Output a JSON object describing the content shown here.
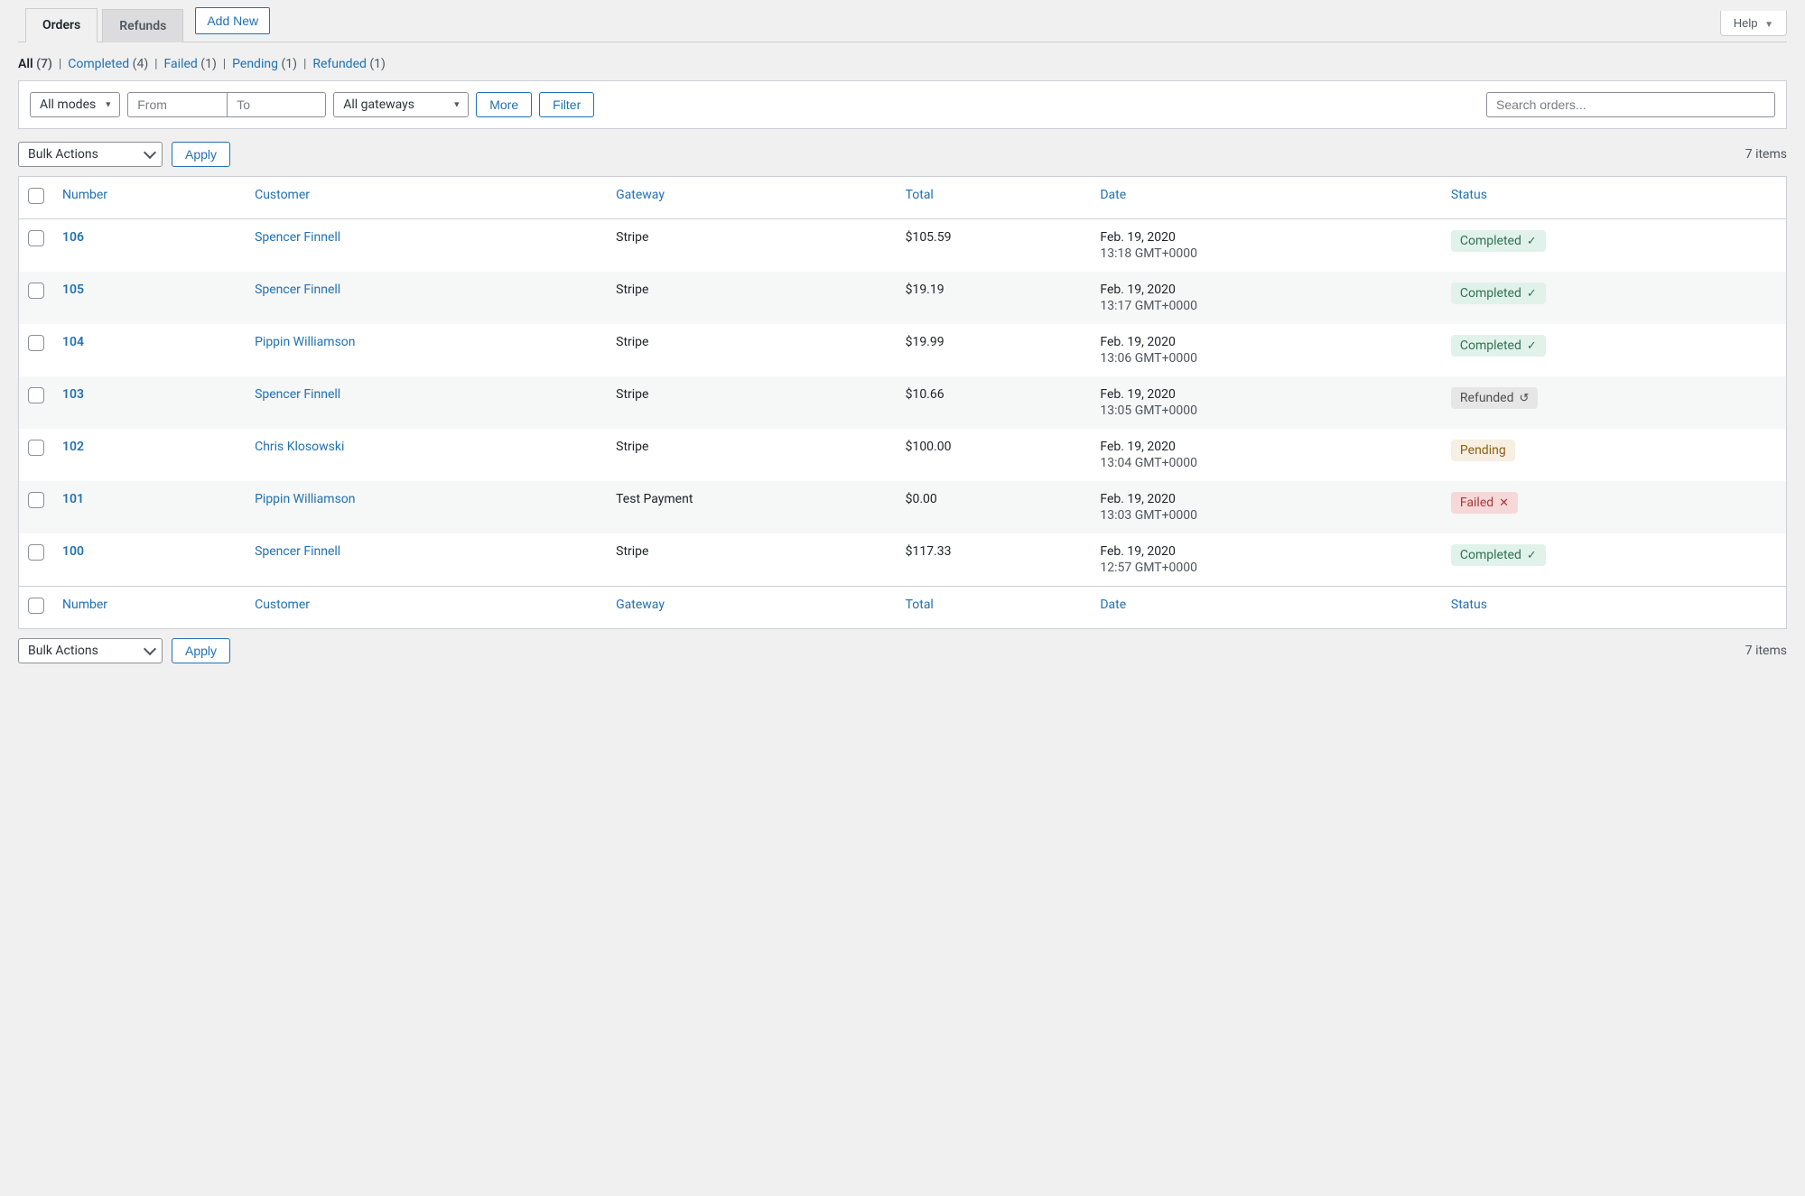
{
  "help_label": "Help",
  "tabs": {
    "orders": "Orders",
    "refunds": "Refunds",
    "add_new": "Add New"
  },
  "filters": {
    "all_label": "All",
    "all_count": "(7)",
    "completed_label": "Completed",
    "completed_count": "(4)",
    "failed_label": "Failed",
    "failed_count": "(1)",
    "pending_label": "Pending",
    "pending_count": "(1)",
    "refunded_label": "Refunded",
    "refunded_count": "(1)"
  },
  "toolbar": {
    "modes_label": "All modes",
    "from_placeholder": "From",
    "to_placeholder": "To",
    "gateways_label": "All gateways",
    "more_label": "More",
    "filter_label": "Filter",
    "search_placeholder": "Search orders...",
    "bulk_label": "Bulk Actions",
    "apply_label": "Apply",
    "item_count": "7 items"
  },
  "columns": {
    "number": "Number",
    "customer": "Customer",
    "gateway": "Gateway",
    "total": "Total",
    "date": "Date",
    "status": "Status"
  },
  "rows": [
    {
      "number": "106",
      "customer": "Spencer Finnell",
      "gateway": "Stripe",
      "total": "$105.59",
      "date": "Feb. 19, 2020",
      "time": "13:18 GMT+0000",
      "status": "Completed",
      "status_kind": "completed",
      "status_icon": "✓"
    },
    {
      "number": "105",
      "customer": "Spencer Finnell",
      "gateway": "Stripe",
      "total": "$19.19",
      "date": "Feb. 19, 2020",
      "time": "13:17 GMT+0000",
      "status": "Completed",
      "status_kind": "completed",
      "status_icon": "✓"
    },
    {
      "number": "104",
      "customer": "Pippin Williamson",
      "gateway": "Stripe",
      "total": "$19.99",
      "date": "Feb. 19, 2020",
      "time": "13:06 GMT+0000",
      "status": "Completed",
      "status_kind": "completed",
      "status_icon": "✓"
    },
    {
      "number": "103",
      "customer": "Spencer Finnell",
      "gateway": "Stripe",
      "total": "$10.66",
      "date": "Feb. 19, 2020",
      "time": "13:05 GMT+0000",
      "status": "Refunded",
      "status_kind": "refunded",
      "status_icon": "↺"
    },
    {
      "number": "102",
      "customer": "Chris Klosowski",
      "gateway": "Stripe",
      "total": "$100.00",
      "date": "Feb. 19, 2020",
      "time": "13:04 GMT+0000",
      "status": "Pending",
      "status_kind": "pending",
      "status_icon": ""
    },
    {
      "number": "101",
      "customer": "Pippin Williamson",
      "gateway": "Test Payment",
      "total": "$0.00",
      "date": "Feb. 19, 2020",
      "time": "13:03 GMT+0000",
      "status": "Failed",
      "status_kind": "failed",
      "status_icon": "✕"
    },
    {
      "number": "100",
      "customer": "Spencer Finnell",
      "gateway": "Stripe",
      "total": "$117.33",
      "date": "Feb. 19, 2020",
      "time": "12:57 GMT+0000",
      "status": "Completed",
      "status_kind": "completed",
      "status_icon": "✓"
    }
  ]
}
